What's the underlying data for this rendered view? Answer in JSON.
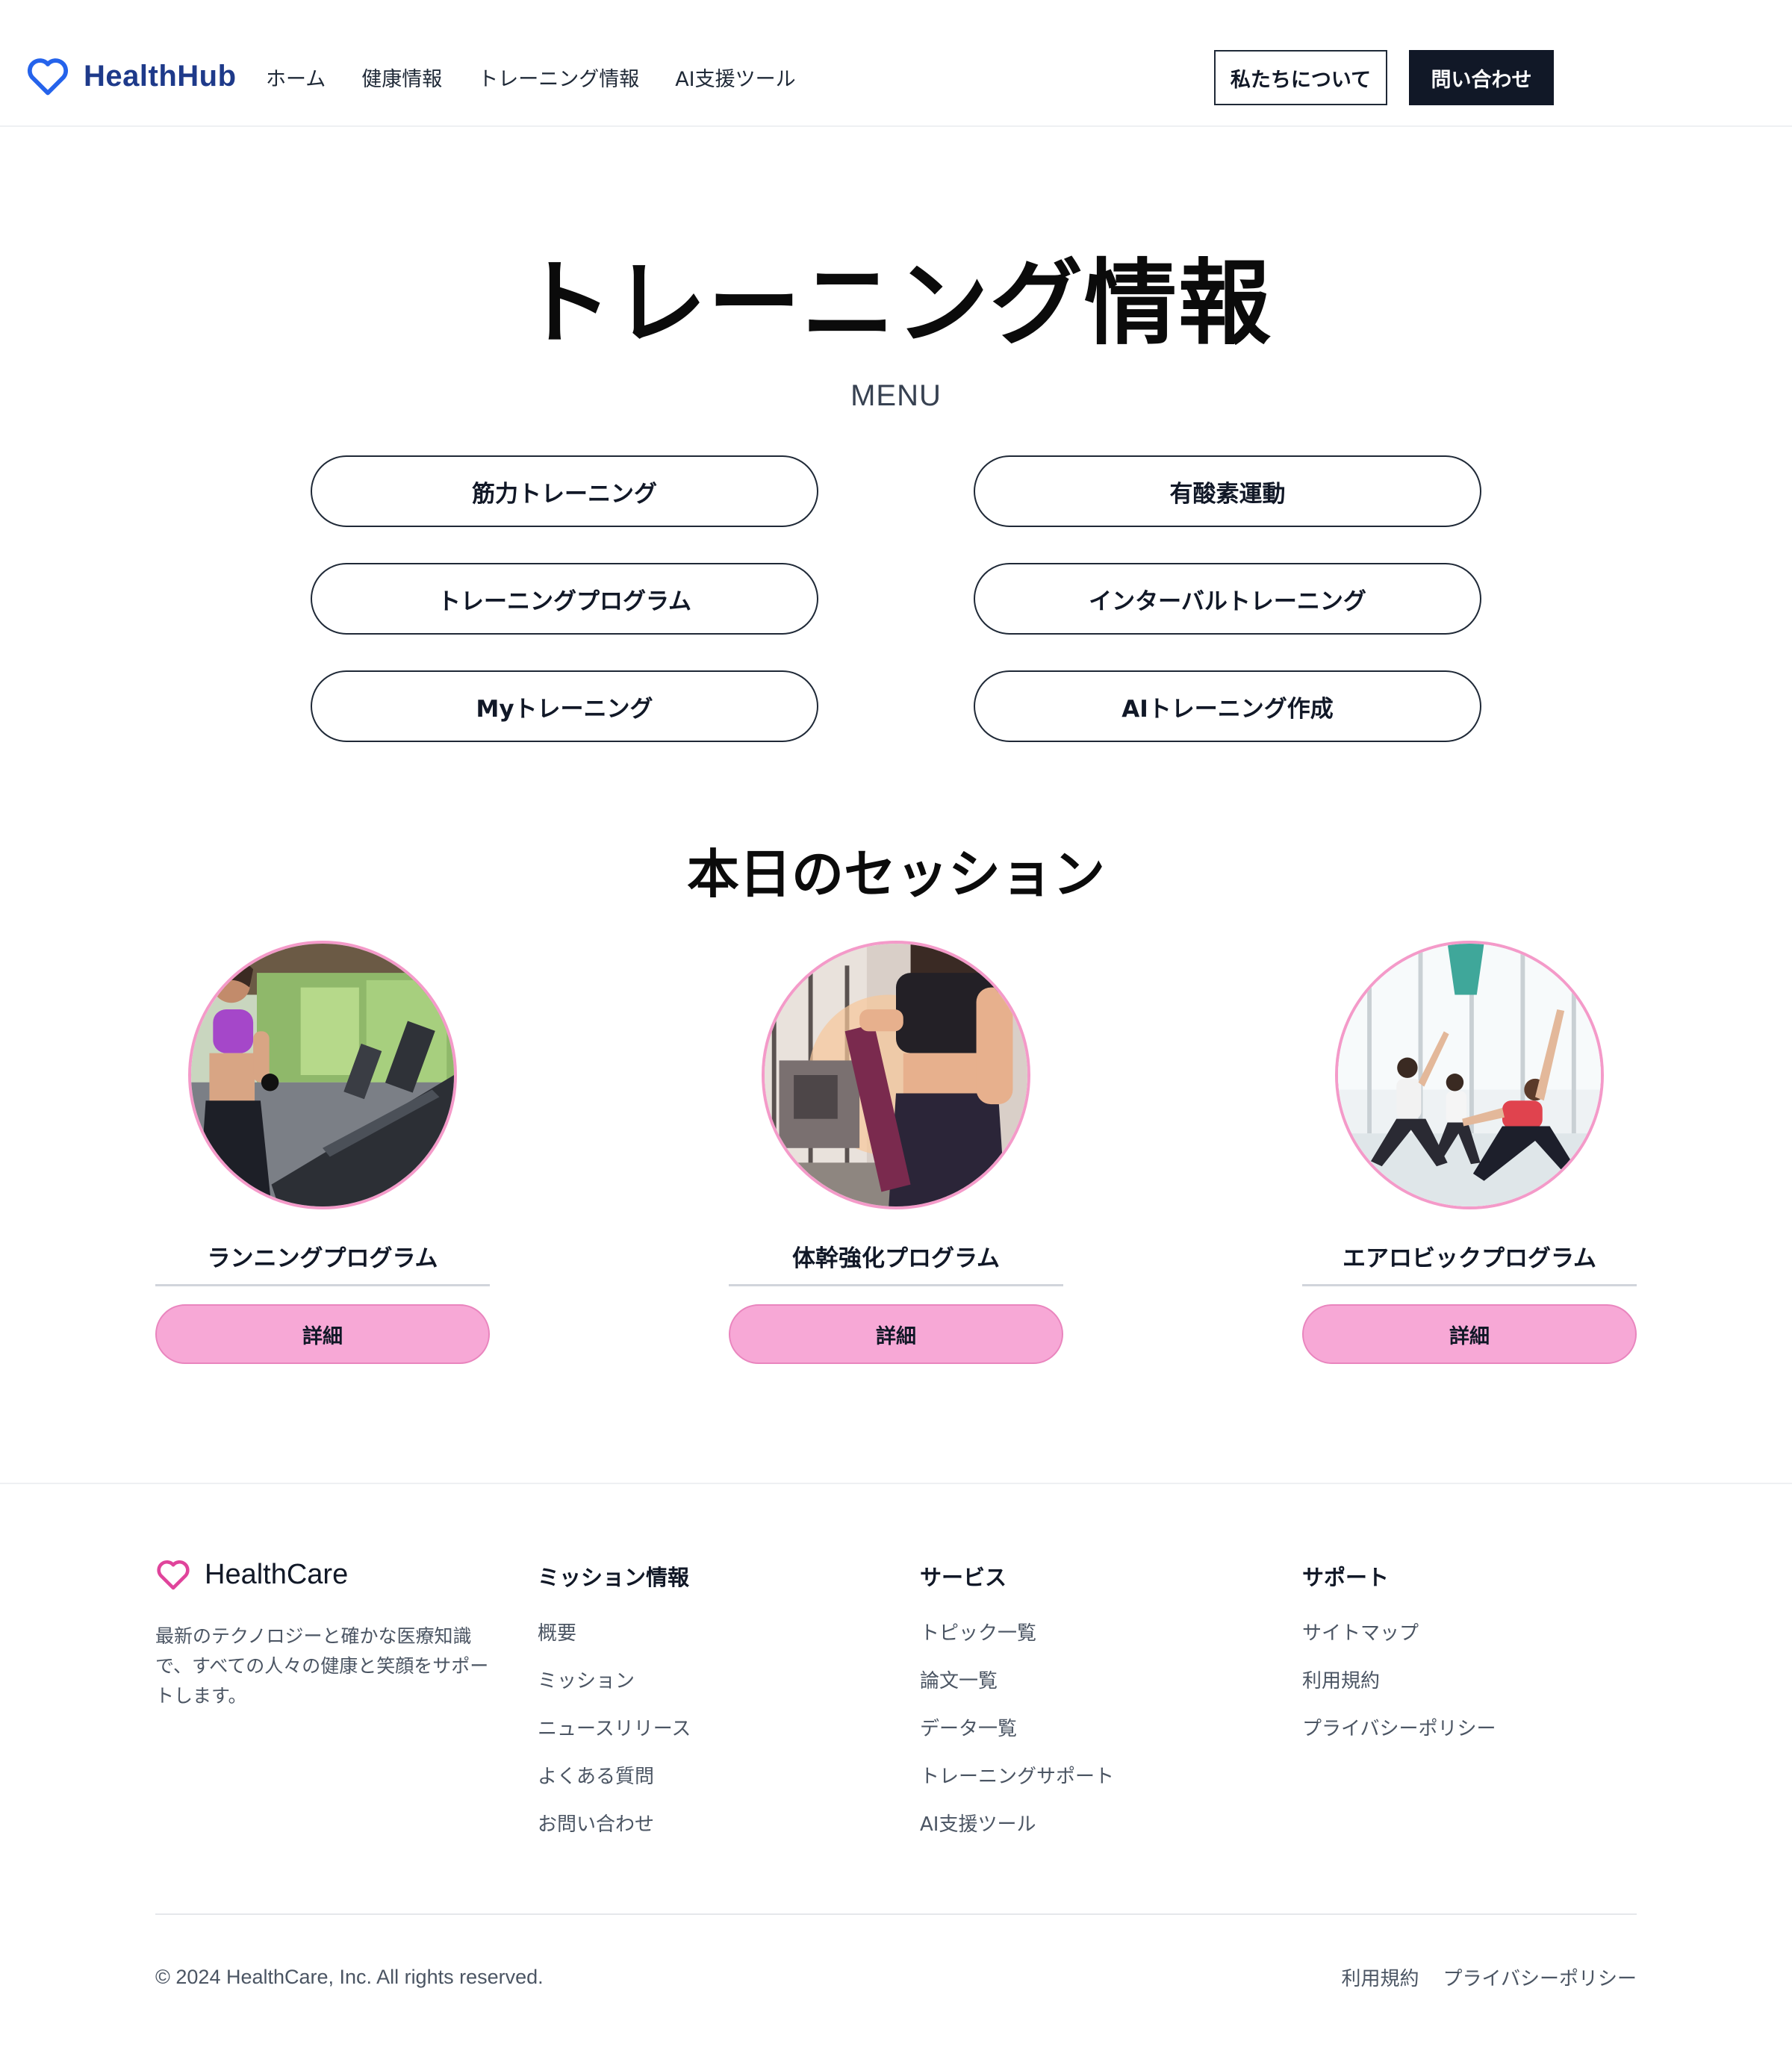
{
  "header": {
    "logo_text": "HealthHub",
    "nav": [
      "ホーム",
      "健康情報",
      "トレーニング情報",
      "AI支援ツール"
    ],
    "about_label": "私たちについて",
    "contact_label": "問い合わせ"
  },
  "hero": {
    "title": "トレーニング情報",
    "menu_label": "MENU",
    "menu_items": [
      "筋力トレーニング",
      "有酸素運動",
      "トレーニングプログラム",
      "インターバルトレーニング",
      "Myトレーニング",
      "AIトレーニング作成"
    ]
  },
  "sessions": {
    "title": "本日のセッション",
    "cards": [
      {
        "title": "ランニングプログラム",
        "button": "詳細"
      },
      {
        "title": "体幹強化プログラム",
        "button": "詳細"
      },
      {
        "title": "エアロビックプログラム",
        "button": "詳細"
      }
    ]
  },
  "footer": {
    "logo_text": "HealthCare",
    "description": "最新のテクノロジーと確かな医療知識で、すべての人々の健康と笑顔をサポートします。",
    "columns": [
      {
        "title": "ミッション情報",
        "links": [
          "概要",
          "ミッション",
          "ニュースリリース",
          "よくある質問",
          "お問い合わせ"
        ]
      },
      {
        "title": "サービス",
        "links": [
          "トピック一覧",
          "論文一覧",
          "データ一覧",
          "トレーニングサポート",
          "AI支援ツール"
        ]
      },
      {
        "title": "サポート",
        "links": [
          "サイトマップ",
          "利用規約",
          "プライバシーポリシー"
        ]
      }
    ],
    "copyright": "© 2024 HealthCare, Inc. All rights reserved.",
    "bottom_links": [
      "利用規約",
      "プライバシーポリシー"
    ]
  },
  "colors": {
    "brand_blue": "#2563eb",
    "logo_text": "#1e3a8a",
    "dark": "#111827",
    "accent_pink": "#f7a8d6",
    "pink_icon": "#e0449b"
  },
  "icons": {
    "header_logo": "heart-outline-icon",
    "footer_logo": "heart-outline-icon"
  }
}
